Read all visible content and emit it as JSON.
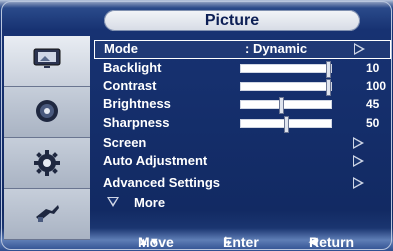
{
  "header": {
    "title": "Picture"
  },
  "sidebar": {
    "items": [
      {
        "icon": "picture-icon",
        "active": true
      },
      {
        "icon": "sound-icon",
        "active": false
      },
      {
        "icon": "setup-gear-icon",
        "active": false
      },
      {
        "icon": "input-plug-icon",
        "active": false
      }
    ]
  },
  "menu": {
    "mode": {
      "label": "Mode",
      "value": ": Dynamic"
    },
    "backlight": {
      "label": "Backlight",
      "value": "10",
      "level_fraction": 1.0
    },
    "contrast": {
      "label": "Contrast",
      "value": "100",
      "level_fraction": 1.0
    },
    "brightness": {
      "label": "Brightness",
      "value": "45",
      "level_fraction": 0.45
    },
    "sharpness": {
      "label": "Sharpness",
      "value": "50",
      "level_fraction": 0.5
    },
    "screen": {
      "label": "Screen"
    },
    "auto_adjustment": {
      "label": "Auto Adjustment"
    },
    "advanced_settings": {
      "label": "Advanced Settings"
    },
    "more": {
      "label": "More"
    }
  },
  "footer": {
    "move": {
      "icon": "updown-icon",
      "label": "Move"
    },
    "enter": {
      "icon": "enter-icon",
      "label": "Enter"
    },
    "return": {
      "icon": "left-arrow-icon",
      "label": "Return"
    }
  }
}
